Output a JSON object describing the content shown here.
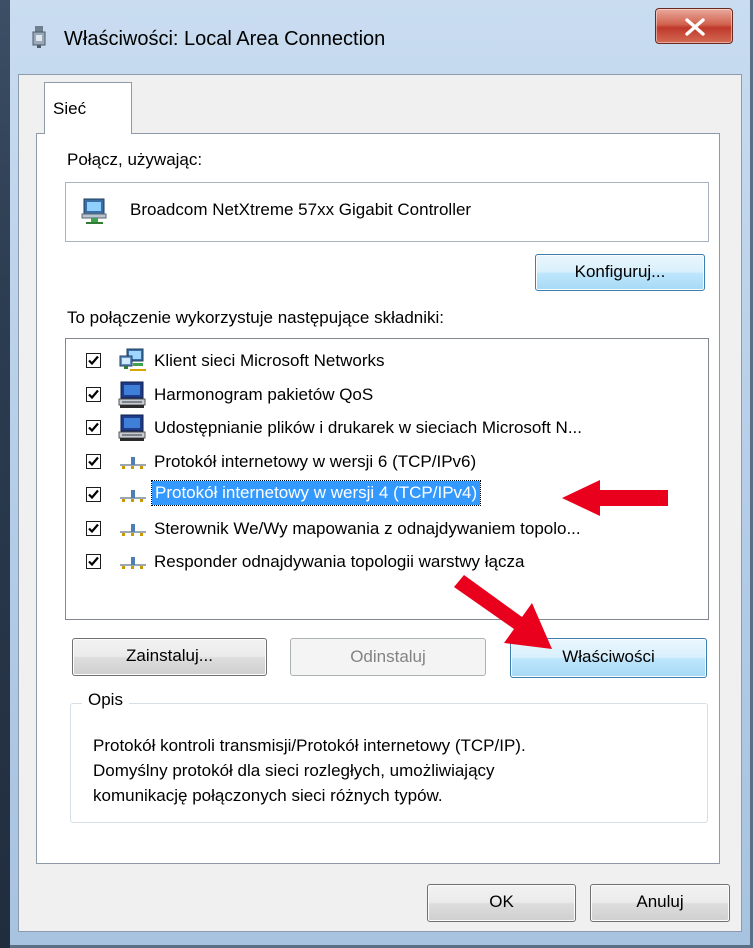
{
  "window": {
    "title": "Właściwości: Local Area Connection"
  },
  "tab": {
    "label": "Sieć"
  },
  "connect_using": {
    "label": "Połącz, używając:",
    "adapter": "Broadcom NetXtreme 57xx Gigabit Controller",
    "configure_button": "Konfiguruj..."
  },
  "components": {
    "label": "To połączenie wykorzystuje następujące składniki:",
    "items": [
      {
        "label": "Klient sieci Microsoft Networks",
        "checked": true,
        "icon": "network-client-icon"
      },
      {
        "label": "Harmonogram pakietów QoS",
        "checked": true,
        "icon": "computer-service-icon"
      },
      {
        "label": "Udostępnianie plików i drukarek w sieciach Microsoft N...",
        "checked": true,
        "icon": "computer-service-icon"
      },
      {
        "label": "Protokół internetowy w wersji 6 (TCP/IPv6)",
        "checked": true,
        "icon": "protocol-icon"
      },
      {
        "label": "Protokół internetowy w wersji 4 (TCP/IPv4)",
        "checked": true,
        "icon": "protocol-icon",
        "selected": true
      },
      {
        "label": "Sterownik We/Wy mapowania z odnajdywaniem topolo...",
        "checked": true,
        "icon": "protocol-icon"
      },
      {
        "label": "Responder odnajdywania topologii warstwy łącza",
        "checked": true,
        "icon": "protocol-icon"
      }
    ]
  },
  "buttons": {
    "install": "Zainstaluj...",
    "uninstall": "Odinstaluj",
    "properties": "Właściwości",
    "ok": "OK",
    "cancel": "Anuluj"
  },
  "description": {
    "title": "Opis",
    "line1": "Protokół kontroli transmisji/Protokół internetowy (TCP/IP).",
    "line2": "Domyślny protokół dla sieci rozległych, umożliwiający",
    "line3": "komunikację połączonych sieci różnych typów."
  },
  "colors": {
    "selection": "#3399ff",
    "annotation_arrow": "#e8001c",
    "close_button": "#c0392b"
  }
}
